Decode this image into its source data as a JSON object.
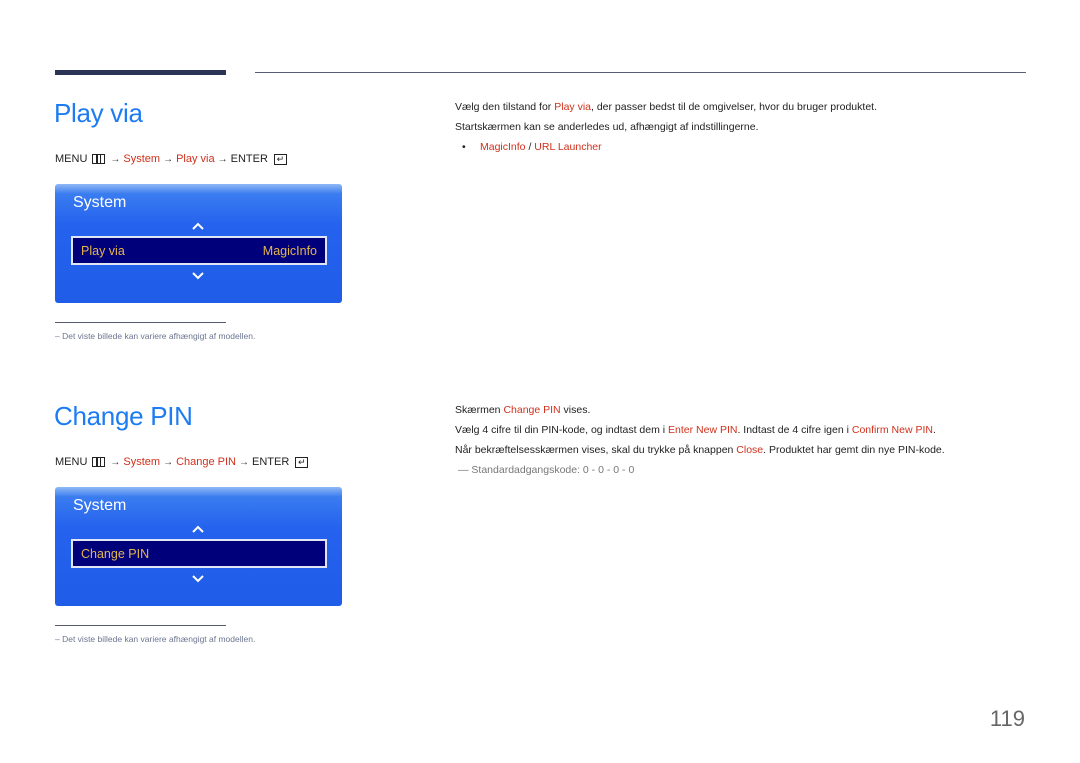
{
  "page": {
    "number": "119",
    "accent_color": "#1d7cf2",
    "highlight_color": "#d0301c"
  },
  "sections": [
    {
      "title": "Play via",
      "menu_path": {
        "menu": "MENU",
        "arrow": "→",
        "system": "System",
        "item": "Play via",
        "enter": "ENTER"
      },
      "osd": {
        "title": "System",
        "selected_label": "Play via",
        "selected_value": "MagicInfo"
      },
      "footnote": "–  Det viste billede kan variere afhængigt af modellen.",
      "body": {
        "line1_pre": "Vælg den tilstand for ",
        "line1_link": "Play via",
        "line1_post": ", der passer bedst til de omgivelser, hvor du bruger produktet.",
        "line2": "Startskærmen kan se anderledes ud, afhængigt af indstillingerne.",
        "bullet_opt1": "MagicInfo",
        "bullet_sep": " / ",
        "bullet_opt2": "URL Launcher"
      }
    },
    {
      "title": "Change PIN",
      "menu_path": {
        "menu": "MENU",
        "arrow": "→",
        "system": "System",
        "item": "Change PIN",
        "enter": "ENTER"
      },
      "osd": {
        "title": "System",
        "selected_label": "Change PIN",
        "selected_value": ""
      },
      "footnote": "–  Det viste billede kan variere afhængigt af modellen.",
      "body": {
        "line1_pre": "Skærmen ",
        "line1_link": "Change PIN",
        "line1_post": " vises.",
        "line2_pre": "Vælg 4 cifre til din PIN-kode, og indtast dem i ",
        "line2_link1": "Enter New PIN",
        "line2_mid": ". Indtast de 4 cifre igen i ",
        "line2_link2": "Confirm New PIN",
        "line2_post": ".",
        "line3_pre": "Når bekræftelsesskærmen vises, skal du trykke på knappen ",
        "line3_link": "Close",
        "line3_post": ". Produktet har gemt din nye PIN-kode.",
        "note": "Standardadgangskode: 0 - 0 - 0 - 0"
      }
    }
  ]
}
